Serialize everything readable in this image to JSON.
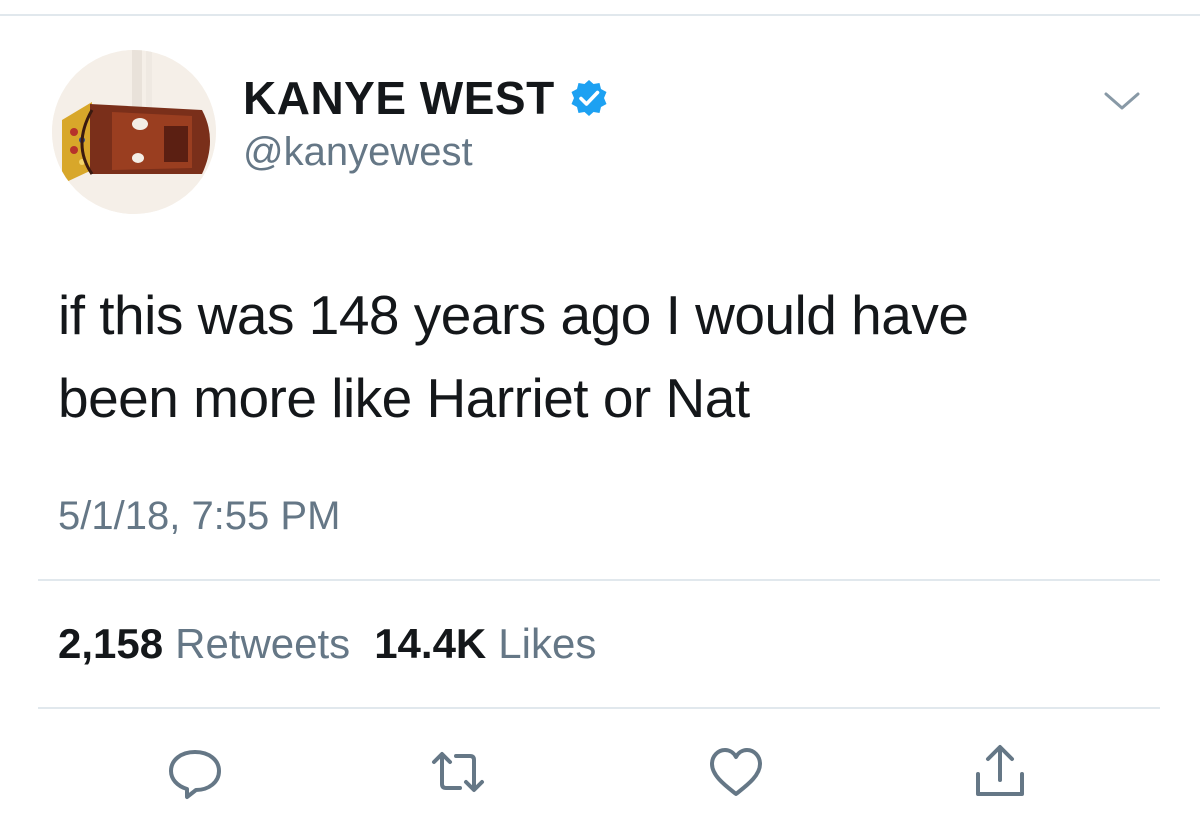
{
  "tweet": {
    "author": {
      "display_name": "KANYE WEST",
      "handle": "@kanyewest",
      "verified": true
    },
    "text_lines": [
      "if this was 148 years ago I would have",
      "been more like Harriet or Nat"
    ],
    "timestamp": "5/1/18, 7:55 PM",
    "stats": {
      "retweets_count": "2,158",
      "retweets_label": "Retweets",
      "likes_count": "14.4K",
      "likes_label": "Likes"
    },
    "actions": [
      {
        "name": "reply",
        "icon": "reply-bubble-icon"
      },
      {
        "name": "retweet",
        "icon": "retweet-arrows-icon"
      },
      {
        "name": "like",
        "icon": "heart-icon"
      },
      {
        "name": "share",
        "icon": "share-upload-icon"
      }
    ]
  },
  "colors": {
    "text_primary": "#14171a",
    "text_secondary": "#657786",
    "verified_blue": "#1da1f2",
    "divider": "#e1e8ed"
  }
}
